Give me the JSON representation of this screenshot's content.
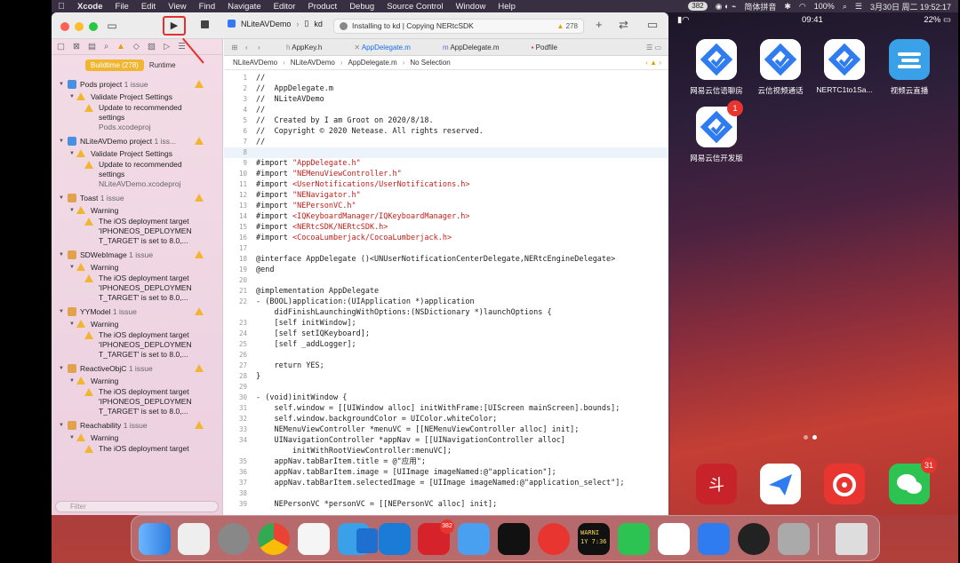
{
  "menubar": {
    "app": "Xcode",
    "items": [
      "File",
      "Edit",
      "View",
      "Find",
      "Navigate",
      "Editor",
      "Product",
      "Debug",
      "Source Control",
      "Window",
      "Help"
    ],
    "right_pill": "382",
    "input_method": "简体拼音",
    "battery": "100%",
    "datetime": "3月30日 周二 19:52:17"
  },
  "xcode": {
    "scheme_target": "NLiteAVDemo",
    "scheme_device": "kd",
    "activity_text": "Installing to kd | Copying NERtcSDK",
    "activity_warning_count": "278",
    "navigator_tabs": [
      "Buildtime (278)",
      "Runtime"
    ],
    "filter_placeholder": "Filter",
    "issues": [
      {
        "type": "project",
        "name": "Pods project",
        "count": "1 issue"
      },
      {
        "type": "group",
        "name": "Validate Project Settings"
      },
      {
        "type": "msg",
        "lines": [
          "Update to recommended",
          "settings"
        ],
        "sub": "Pods.xcodeproj"
      },
      {
        "type": "project",
        "name": "NLiteAVDemo project",
        "count": "1 iss..."
      },
      {
        "type": "group",
        "name": "Validate Project Settings"
      },
      {
        "type": "msg",
        "lines": [
          "Update to recommended",
          "settings"
        ],
        "sub": "NLiteAVDemo.xcodeproj"
      },
      {
        "type": "folder",
        "name": "Toast",
        "count": "1 issue"
      },
      {
        "type": "group",
        "name": "Warning"
      },
      {
        "type": "msg",
        "lines": [
          "The iOS deployment target",
          "'IPHONEOS_DEPLOYMEN",
          "T_TARGET' is set to 8.0,..."
        ]
      },
      {
        "type": "folder",
        "name": "SDWebImage",
        "count": "1 issue"
      },
      {
        "type": "group",
        "name": "Warning"
      },
      {
        "type": "msg",
        "lines": [
          "The iOS deployment target",
          "'IPHONEOS_DEPLOYMEN",
          "T_TARGET' is set to 8.0,..."
        ]
      },
      {
        "type": "folder",
        "name": "YYModel",
        "count": "1 issue"
      },
      {
        "type": "group",
        "name": "Warning"
      },
      {
        "type": "msg",
        "lines": [
          "The iOS deployment target",
          "'IPHONEOS_DEPLOYMEN",
          "T_TARGET' is set to 8.0,..."
        ]
      },
      {
        "type": "folder",
        "name": "ReactiveObjC",
        "count": "1 issue"
      },
      {
        "type": "group",
        "name": "Warning"
      },
      {
        "type": "msg",
        "lines": [
          "The iOS deployment target",
          "'IPHONEOS_DEPLOYMEN",
          "T_TARGET' is set to 8.0,..."
        ]
      },
      {
        "type": "folder",
        "name": "Reachability",
        "count": "1 issue"
      },
      {
        "type": "group",
        "name": "Warning"
      },
      {
        "type": "msg",
        "lines": [
          "The iOS deployment target"
        ]
      }
    ],
    "editor_tabs": [
      "AppKey.h",
      "AppDelegate.m",
      "AppDelegate.m",
      "Podfile"
    ],
    "active_tab": 1,
    "jumpbar": [
      "NLiteAVDemo",
      "NLiteAVDemo",
      "AppDelegate.m",
      "No Selection"
    ],
    "code": [
      {
        "n": "1",
        "t": "//",
        "c": "com"
      },
      {
        "n": "2",
        "t": "//  AppDelegate.m",
        "c": "com"
      },
      {
        "n": "3",
        "t": "//  NLiteAVDemo",
        "c": "com"
      },
      {
        "n": "4",
        "t": "//",
        "c": "com"
      },
      {
        "n": "5",
        "t": "//  Created by I am Groot on 2020/8/18.",
        "c": "com"
      },
      {
        "n": "6",
        "t": "//  Copyright © 2020 Netease. All rights reserved.",
        "c": "com"
      },
      {
        "n": "7",
        "t": "//",
        "c": "com"
      },
      {
        "n": "8",
        "t": "",
        "c": "cur"
      },
      {
        "n": "9",
        "t": "#import \"AppDelegate.h\"",
        "c": "imp"
      },
      {
        "n": "10",
        "t": "#import \"NEMenuViewController.h\"",
        "c": "imp"
      },
      {
        "n": "11",
        "t": "#import <UserNotifications/UserNotifications.h>",
        "c": "imp"
      },
      {
        "n": "12",
        "t": "#import \"NENavigator.h\"",
        "c": "imp"
      },
      {
        "n": "13",
        "t": "#import \"NEPersonVC.h\"",
        "c": "imp"
      },
      {
        "n": "14",
        "t": "#import <IQKeyboardManager/IQKeyboardManager.h>",
        "c": "imp"
      },
      {
        "n": "15",
        "t": "#import <NERtcSDK/NERtcSDK.h>",
        "c": "imp"
      },
      {
        "n": "16",
        "t": "#import <CocoaLumberjack/CocoaLumberjack.h>",
        "c": "imp"
      },
      {
        "n": "17",
        "t": "",
        "c": ""
      },
      {
        "n": "18",
        "t": "@interface AppDelegate ()<UNUserNotificationCenterDelegate,NERtcEngineDelegate>",
        "c": "kw"
      },
      {
        "n": "19",
        "t": "@end",
        "c": "kw"
      },
      {
        "n": "20",
        "t": "",
        "c": ""
      },
      {
        "n": "21",
        "t": "@implementation AppDelegate",
        "c": "kw"
      },
      {
        "n": "22",
        "t": "- (BOOL)application:(UIApplication *)application",
        "c": "plain"
      },
      {
        "n": "",
        "t": "    didFinishLaunchingWithOptions:(NSDictionary *)launchOptions {",
        "c": "plain"
      },
      {
        "n": "23",
        "t": "    [self initWindow];",
        "c": "plain"
      },
      {
        "n": "24",
        "t": "    [self setIQKeyboard];",
        "c": "plain"
      },
      {
        "n": "25",
        "t": "    [self _addLogger];",
        "c": "plain"
      },
      {
        "n": "26",
        "t": "",
        "c": ""
      },
      {
        "n": "27",
        "t": "    return YES;",
        "c": "plain"
      },
      {
        "n": "28",
        "t": "}",
        "c": "plain"
      },
      {
        "n": "29",
        "t": "",
        "c": ""
      },
      {
        "n": "30",
        "t": "- (void)initWindow {",
        "c": "plain"
      },
      {
        "n": "31",
        "t": "    self.window = [[UIWindow alloc] initWithFrame:[UIScreen mainScreen].bounds];",
        "c": "plain"
      },
      {
        "n": "32",
        "t": "    self.window.backgroundColor = UIColor.whiteColor;",
        "c": "plain"
      },
      {
        "n": "33",
        "t": "    NEMenuViewController *menuVC = [[NEMenuViewController alloc] init];",
        "c": "plain"
      },
      {
        "n": "34",
        "t": "    UINavigationController *appNav = [[UINavigationController alloc]",
        "c": "plain"
      },
      {
        "n": "",
        "t": "        initWithRootViewController:menuVC];",
        "c": "plain"
      },
      {
        "n": "35",
        "t": "    appNav.tabBarItem.title = @\"应用\";",
        "c": "plain"
      },
      {
        "n": "36",
        "t": "    appNav.tabBarItem.image = [UIImage imageNamed:@\"application\"];",
        "c": "plain"
      },
      {
        "n": "37",
        "t": "    appNav.tabBarItem.selectedImage = [UIImage imageNamed:@\"application_select\"];",
        "c": "plain"
      },
      {
        "n": "38",
        "t": "",
        "c": ""
      },
      {
        "n": "39",
        "t": "    NEPersonVC *personVC = [[NEPersonVC alloc] init];",
        "c": "plain"
      }
    ]
  },
  "ipad": {
    "time": "09:41",
    "battery": "22%",
    "apps": [
      {
        "label": "网易云信语聊房"
      },
      {
        "label": "云信视频通话"
      },
      {
        "label": "NERTC1to1Sa..."
      },
      {
        "label": "视频云直播"
      },
      {
        "label": "网易云信开发版",
        "badge": "1"
      }
    ],
    "dock_badge": "31"
  },
  "dock": {
    "badge_netease": "382",
    "terminal_text": "WARNI\n1Y 7:36"
  },
  "colors": {
    "accent": "#f2b530",
    "run_highlight": "#e53030",
    "warning": "#f2b530"
  }
}
